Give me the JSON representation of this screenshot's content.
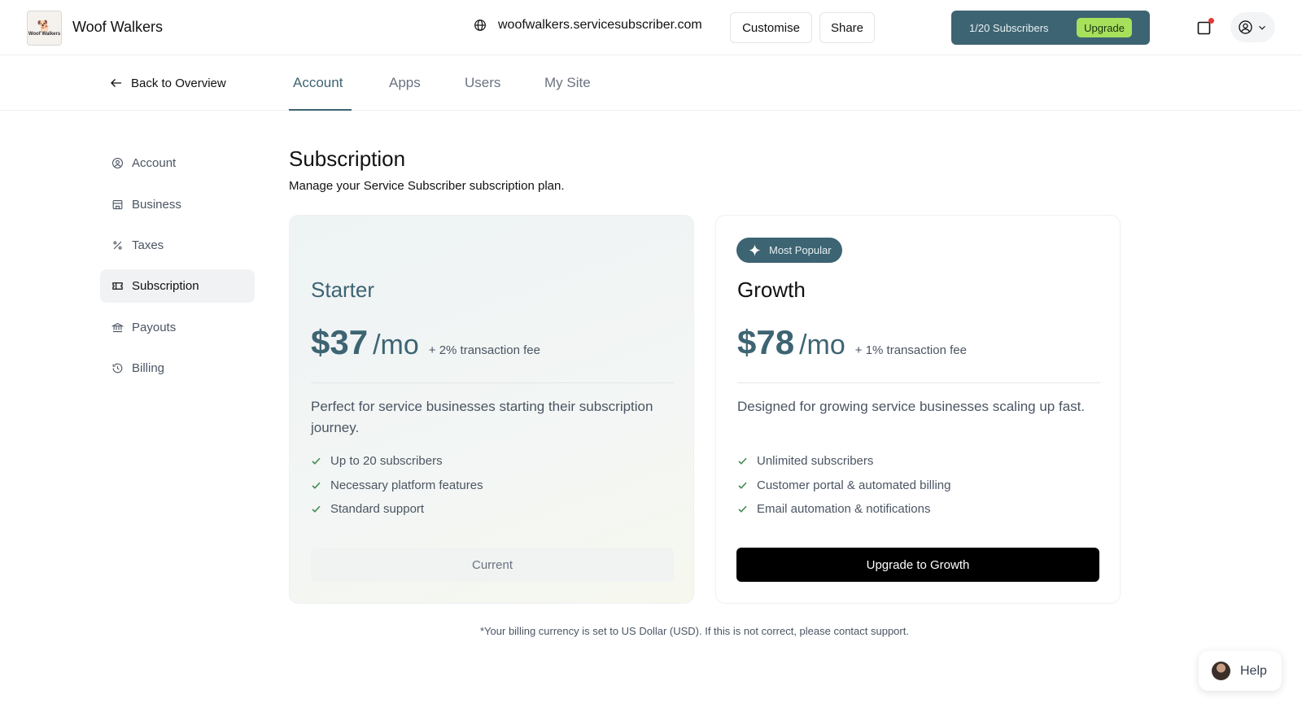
{
  "header": {
    "business_name": "Woof Walkers",
    "logo_text": "Woof Walkers",
    "domain": "woofwalkers.servicesubscriber.com",
    "customise_label": "Customise",
    "share_label": "Share",
    "subscribers": "1/20 Subscribers",
    "upgrade_label": "Upgrade"
  },
  "subnav": {
    "back_label": "Back to Overview",
    "tabs": [
      {
        "label": "Account",
        "active": true
      },
      {
        "label": "Apps",
        "active": false
      },
      {
        "label": "Users",
        "active": false
      },
      {
        "label": "My Site",
        "active": false
      }
    ]
  },
  "sidebar": {
    "items": [
      {
        "label": "Account",
        "icon": "user-circle-icon",
        "active": false
      },
      {
        "label": "Business",
        "icon": "store-icon",
        "active": false
      },
      {
        "label": "Taxes",
        "icon": "percent-icon",
        "active": false
      },
      {
        "label": "Subscription",
        "icon": "ticket-icon",
        "active": true
      },
      {
        "label": "Payouts",
        "icon": "bank-icon",
        "active": false
      },
      {
        "label": "Billing",
        "icon": "history-icon",
        "active": false
      }
    ]
  },
  "main": {
    "title": "Subscription",
    "description": "Manage your Service Subscriber subscription plan.",
    "plans": [
      {
        "name": "Starter",
        "price": "$37",
        "period": "/mo",
        "fee": "+ 2% transaction fee",
        "description": "Perfect for service businesses starting their subscription journey.",
        "features": [
          "Up to 20 subscribers",
          "Necessary platform features",
          "Standard support"
        ],
        "button": "Current"
      },
      {
        "badge": "Most Popular",
        "name": "Growth",
        "price": "$78",
        "period": "/mo",
        "fee": "+ 1% transaction fee",
        "description": "Designed for growing service businesses scaling up fast.",
        "features": [
          "Unlimited subscribers",
          "Customer portal & automated billing",
          "Email automation & notifications"
        ],
        "button": "Upgrade to Growth"
      }
    ],
    "footnote": "*Your billing currency is set to US Dollar (USD). If this is not correct, please contact support."
  },
  "help": {
    "label": "Help"
  },
  "colors": {
    "accent": "#3d6472",
    "upgrade_pill": "#a7e15c",
    "primary_button": "#000000"
  }
}
